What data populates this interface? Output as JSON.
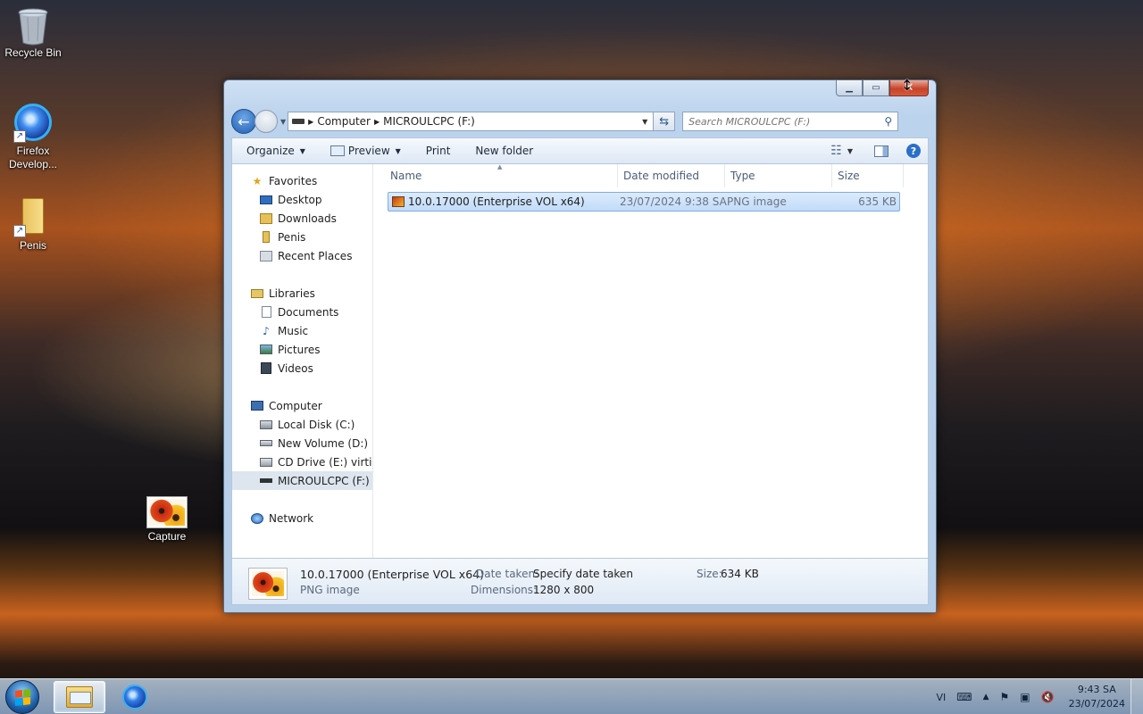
{
  "desktop": {
    "icons": [
      {
        "label": "Recycle Bin",
        "icon": "recycle-bin-icon"
      },
      {
        "label": "Firefox\nDevelop...",
        "label_line1": "Firefox",
        "label_line2": "Develop...",
        "icon": "firefox-icon"
      },
      {
        "label": "Penis",
        "icon": "folder-icon"
      },
      {
        "label": "Capture",
        "icon": "image-file-icon"
      }
    ]
  },
  "window": {
    "address": {
      "segments": [
        "Computer",
        "MICROULCPC (F:)"
      ]
    },
    "search": {
      "placeholder": "Search MICROULCPC (F:)"
    },
    "toolbar": {
      "organize": "Organize",
      "preview": "Preview",
      "print": "Print",
      "new_folder": "New folder"
    },
    "nav": {
      "favorites": "Favorites",
      "favorites_items": [
        "Desktop",
        "Downloads",
        "Penis",
        "Recent Places"
      ],
      "libraries": "Libraries",
      "libraries_items": [
        "Documents",
        "Music",
        "Pictures",
        "Videos"
      ],
      "computer": "Computer",
      "computer_items": [
        "Local Disk (C:)",
        "New Volume (D:)",
        "CD Drive (E:) virtio-v",
        "MICROULCPC (F:)"
      ],
      "network": "Network",
      "selected": "MICROULCPC (F:)"
    },
    "columns": {
      "name": "Name",
      "date_modified": "Date modified",
      "type": "Type",
      "size": "Size"
    },
    "files": [
      {
        "name": "10.0.17000 (Enterprise VOL x64)",
        "date_modified": "23/07/2024 9:38 SA",
        "type": "PNG image",
        "size": "635 KB"
      }
    ],
    "details": {
      "name": "10.0.17000 (Enterprise VOL x64)",
      "type": "PNG image",
      "date_taken_label": "Date taken:",
      "date_taken_value": "Specify date taken",
      "dimensions_label": "Dimensions:",
      "dimensions_value": "1280 x 800",
      "size_label": "Size:",
      "size_value": "634 KB"
    }
  },
  "taskbar": {
    "language": "VI",
    "time": "9:43 SA",
    "date": "23/07/2024"
  }
}
